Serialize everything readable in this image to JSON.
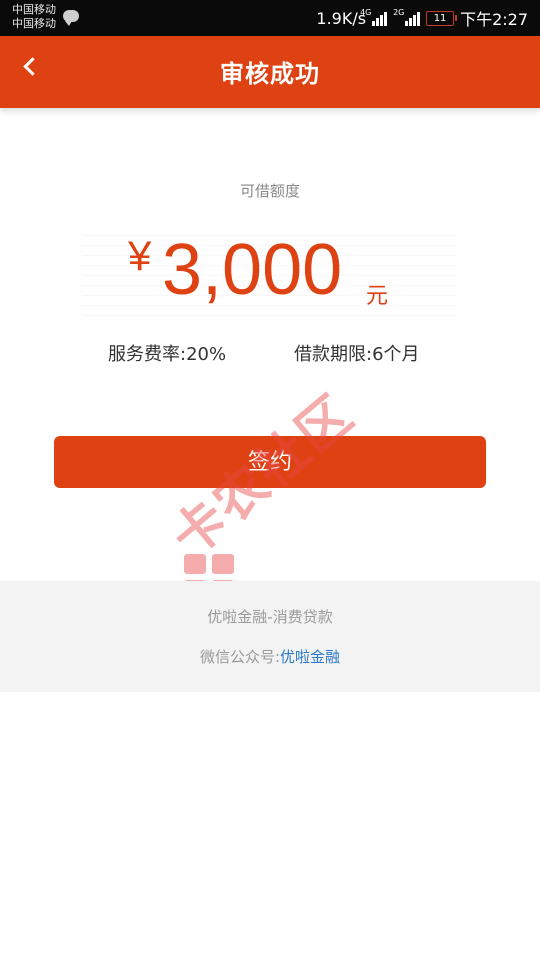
{
  "status_bar": {
    "carrier_1": "中国移动",
    "carrier_2": "中国移动",
    "net_speed": "1.9K/s",
    "network_1": "4G",
    "network_2": "2G",
    "battery": "11",
    "time": "下午2:27"
  },
  "header": {
    "title": "审核成功",
    "background_color": "#df4212"
  },
  "credit": {
    "label": "可借额度",
    "currency_symbol": "¥",
    "amount": "3,000",
    "unit": "元"
  },
  "details": {
    "fee": "服务费率:20%",
    "term": "借款期限:6个月"
  },
  "actions": {
    "sign_label": "签约"
  },
  "watermark": {
    "text": "卡农社区"
  },
  "footer": {
    "line1": "优啦金融-消费贷款",
    "wechat_prefix": "微信公众号:",
    "wechat_name": "优啦金融"
  },
  "colors": {
    "accent": "#df4212",
    "link": "#2a78c5"
  }
}
